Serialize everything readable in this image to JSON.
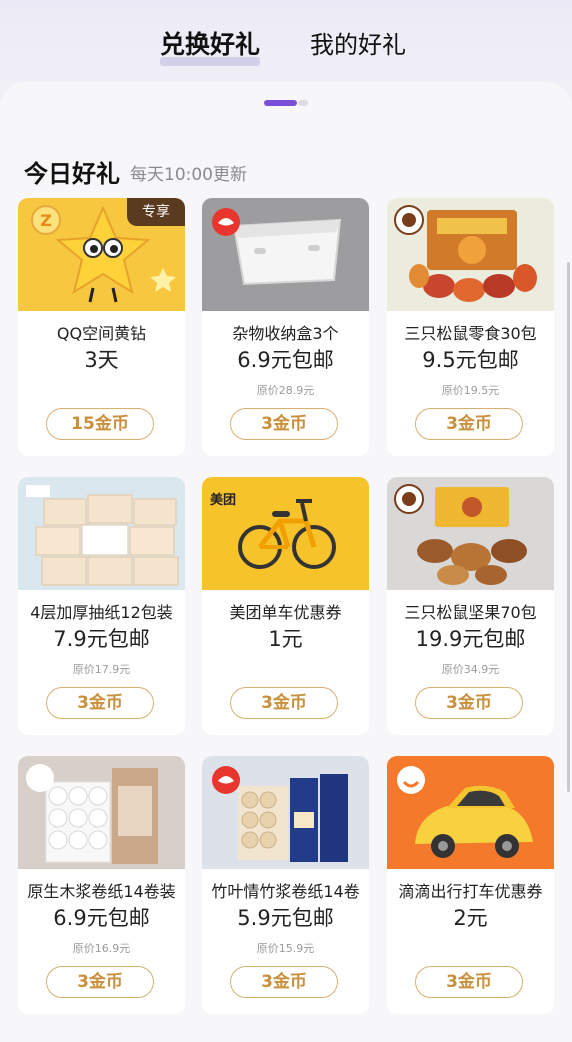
{
  "tabs": {
    "exchange": "兑换好礼",
    "mine": "我的好礼"
  },
  "section": {
    "title": "今日好礼",
    "subtitle": "每天10:00更新"
  },
  "cards": [
    {
      "title": "QQ空间黄钻",
      "price": "3天",
      "original": "",
      "cost": "15金币",
      "tag": "专享"
    },
    {
      "title": "杂物收纳盒3个",
      "price": "6.9元包邮",
      "original": "原价28.9元",
      "cost": "3金币"
    },
    {
      "title": "三只松鼠零食30包",
      "price": "9.5元包邮",
      "original": "原价19.5元",
      "cost": "3金币"
    },
    {
      "title": "4层加厚抽纸12包装",
      "price": "7.9元包邮",
      "original": "原价17.9元",
      "cost": "3金币"
    },
    {
      "title": "美团单车优惠券",
      "price": "1元",
      "original": "",
      "cost": "3金币",
      "brand": "美团"
    },
    {
      "title": "三只松鼠坚果70包",
      "price": "19.9元包邮",
      "original": "原价34.9元",
      "cost": "3金币"
    },
    {
      "title": "原生木浆卷纸14卷装",
      "price": "6.9元包邮",
      "original": "原价16.9元",
      "cost": "3金币"
    },
    {
      "title": "竹叶情竹浆卷纸14卷",
      "price": "5.9元包邮",
      "original": "原价15.9元",
      "cost": "3金币"
    },
    {
      "title": "滴滴出行打车优惠券",
      "price": "2元",
      "original": "",
      "cost": "3金币"
    }
  ],
  "colors": {
    "accent": "#7c4fd9",
    "coin": "#c98f3a",
    "coin_border": "#d8b071"
  }
}
